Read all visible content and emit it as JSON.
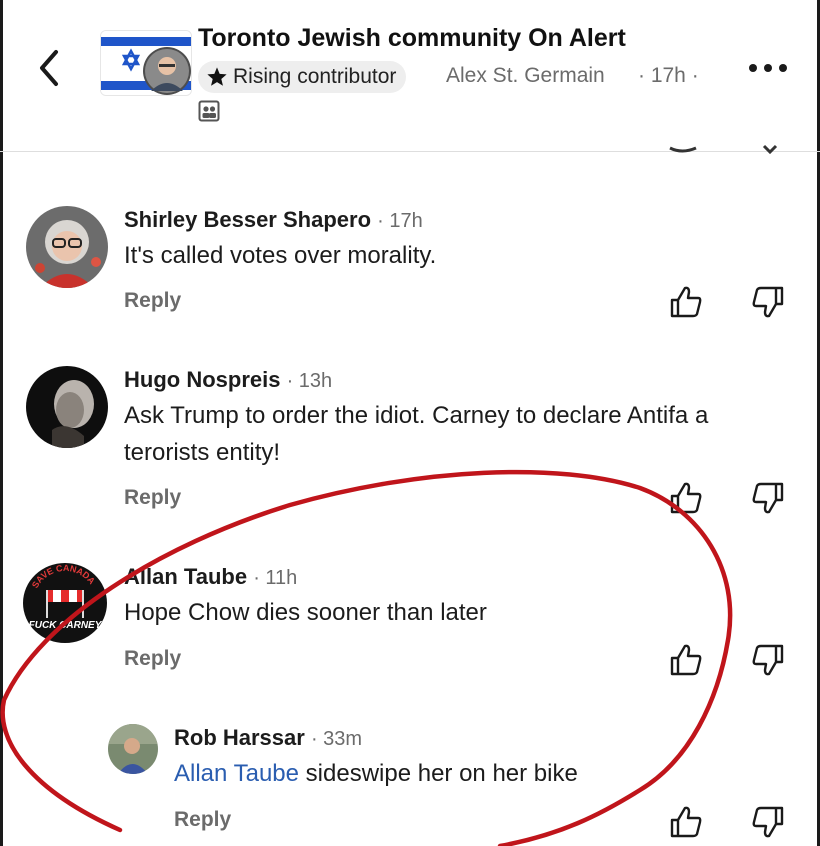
{
  "header": {
    "group_name": "Toronto Jewish community On Alert",
    "badge_label": "Rising contributor",
    "post_author": "Alex St. Germain",
    "post_time": "· 17h ·"
  },
  "comments": [
    {
      "author": "Shirley Besser Shapero",
      "time": "· 17h",
      "text": "It's called votes over morality.",
      "reply_label": "Reply"
    },
    {
      "author": "Hugo Nospreis",
      "time": "· 13h",
      "text": "Ask Trump to order the idiot. Carney to declare Antifa a terorists entity!",
      "reply_label": "Reply"
    },
    {
      "author": "Allan Taube",
      "time": "· 11h",
      "text": "Hope Chow dies sooner than later",
      "reply_label": "Reply",
      "avatar_text_top": "SAVE CANADA",
      "avatar_text_bottom": "FUCK CARNEY"
    },
    {
      "author": "Rob Harssar",
      "time": "· 33m",
      "mention": "Allan Taube",
      "text": " sideswipe her on her bike",
      "reply_label": "Reply"
    }
  ],
  "colors": {
    "accent_link": "#2a5db0",
    "annotation": "#c0151b",
    "israel_blue": "#1f55c9"
  },
  "icons": [
    "back-arrow-icon",
    "star-icon",
    "members-icon",
    "more-options-icon",
    "thumbs-up-icon",
    "thumbs-down-icon"
  ]
}
